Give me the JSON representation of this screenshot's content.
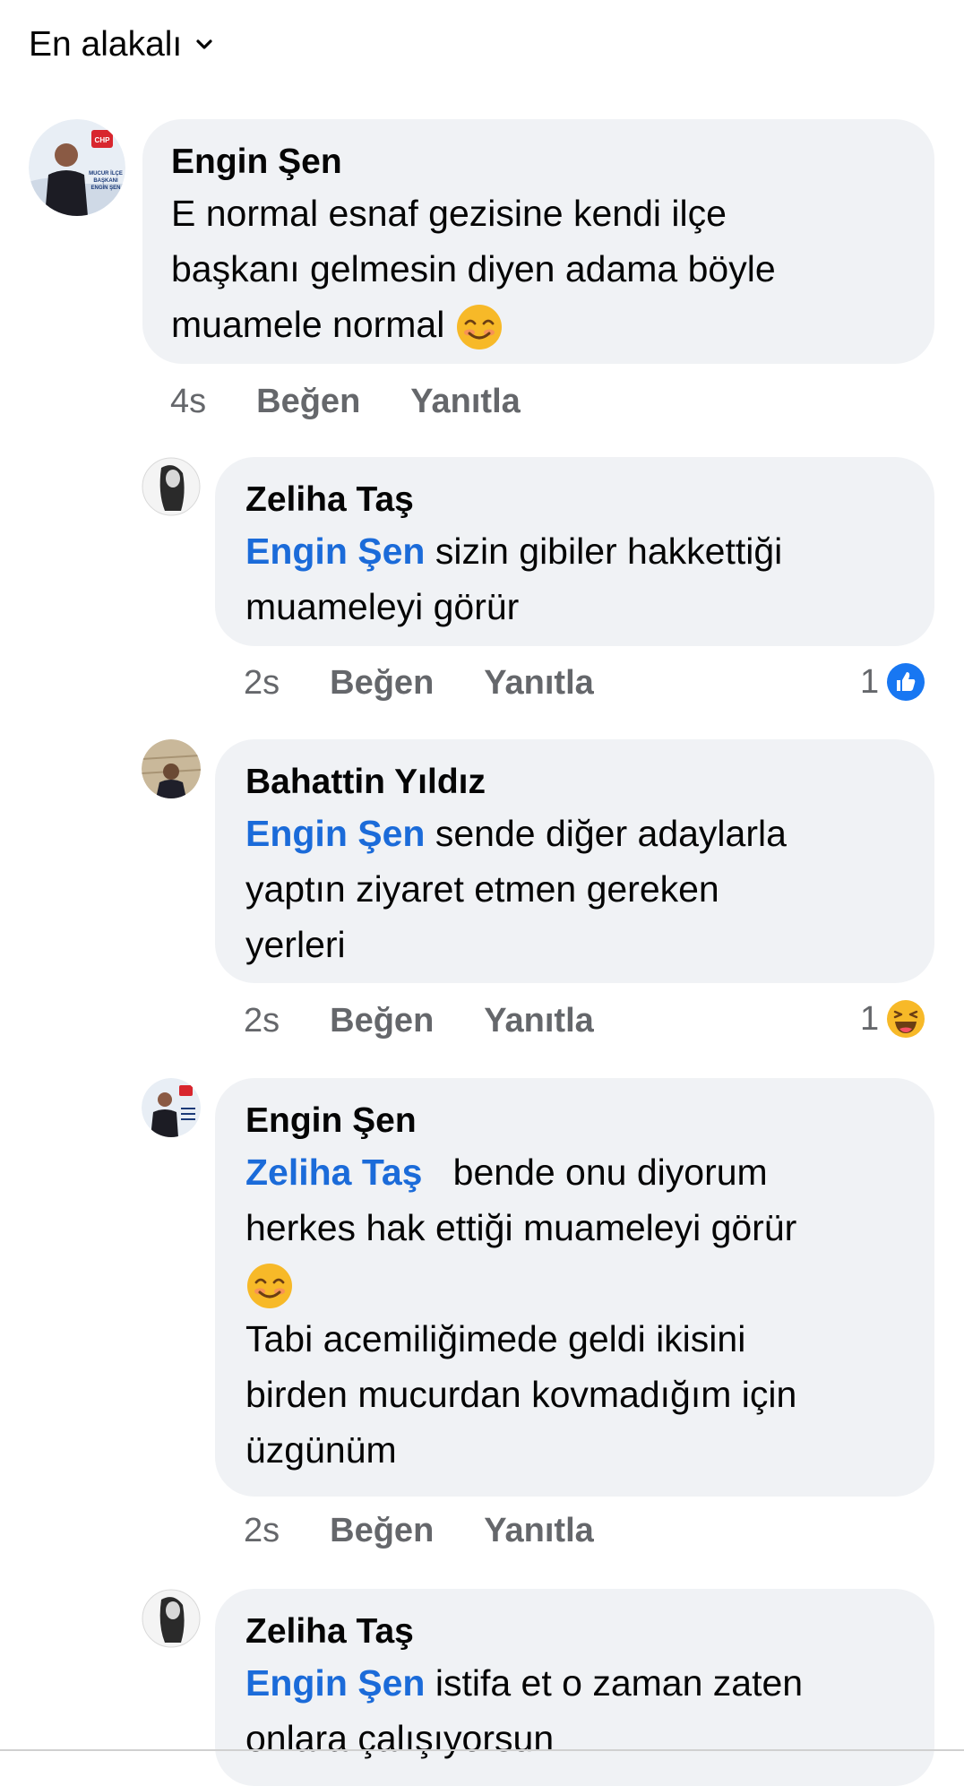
{
  "sort": {
    "label": "En alakalı",
    "icon": "chevron-down-icon"
  },
  "comments": [
    {
      "author": "Engin Şen",
      "text_lines": [
        "E normal esnaf gezisine  kendi ilçe",
        "başkanı gelmesin diyen adama böyle",
        "muamele normal"
      ],
      "emoji": "smiling-face-icon",
      "time": "4s",
      "like": "Beğen",
      "reply": "Yanıtla",
      "avatar_text": [
        "CHP",
        "MUCUR İLÇE",
        "BAŞKANI",
        "ENGİN ŞEN"
      ]
    },
    {
      "author": "Zeliha Taş",
      "mention": "Engin Şen",
      "text_first": " sizin gibiler hakkettiği",
      "text_rest": [
        "muameleyi görür"
      ],
      "time": "2s",
      "like": "Beğen",
      "reply": "Yanıtla",
      "reaction_count": "1",
      "reaction": "like-icon"
    },
    {
      "author": "Bahattin Yıldız",
      "mention": "Engin Şen",
      "text_first": " sende diğer adaylarla",
      "text_rest": [
        "yaptın ziyaret etmen gereken",
        "yerleri"
      ],
      "time": "2s",
      "like": "Beğen",
      "reply": "Yanıtla",
      "reaction_count": "1",
      "reaction": "laughing-face-icon"
    },
    {
      "author": "Engin Şen",
      "mention": "Zeliha Taş",
      "text_first": "   bende onu diyorum",
      "text_rest": [
        "herkes hak ettiği muameleyi görür"
      ],
      "emoji": "smiling-face-icon",
      "text_after": [
        "Tabi acemiliğimede geldi ikisini",
        "birden mucurdan kovmadığım için",
        "üzgünüm"
      ],
      "time": "2s",
      "like": "Beğen",
      "reply": "Yanıtla"
    },
    {
      "author": "Zeliha Taş",
      "mention": "Engin Şen",
      "text_first": " istifa et o zaman zaten",
      "text_rest": [
        "onlara çalışıyorsun"
      ]
    }
  ],
  "colors": {
    "bubble": "#f0f2f5",
    "mention": "#1b6bd9",
    "meta": "#65676b",
    "like": "#1877f2",
    "emoji": "#f7b928"
  }
}
